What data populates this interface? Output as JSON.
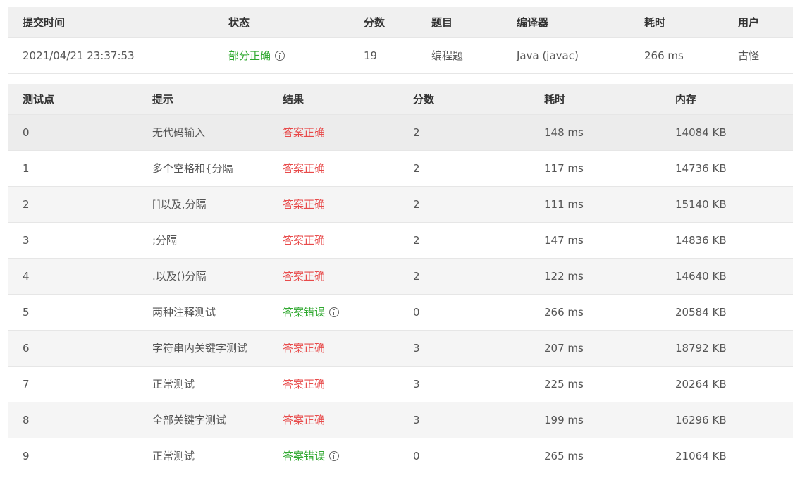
{
  "submission": {
    "headers": [
      "提交时间",
      "状态",
      "分数",
      "题目",
      "编译器",
      "耗时",
      "用户"
    ],
    "row": {
      "time": "2021/04/21 23:37:53",
      "status": "部分正确",
      "score": "19",
      "problem": "编程题",
      "compiler": "Java (javac)",
      "duration": "266 ms",
      "user": "古怪"
    }
  },
  "tests": {
    "headers": [
      "测试点",
      "提示",
      "结果",
      "分数",
      "耗时",
      "内存"
    ],
    "rows": [
      {
        "id": "0",
        "hint": "无代码输入",
        "result": "答案正确",
        "score": "2",
        "time": "148 ms",
        "memory": "14084 KB"
      },
      {
        "id": "1",
        "hint": "多个空格和{分隔",
        "result": "答案正确",
        "score": "2",
        "time": "117 ms",
        "memory": "14736 KB"
      },
      {
        "id": "2",
        "hint": "[]以及,分隔",
        "result": "答案正确",
        "score": "2",
        "time": "111 ms",
        "memory": "15140 KB"
      },
      {
        "id": "3",
        "hint": ";分隔",
        "result": "答案正确",
        "score": "2",
        "time": "147 ms",
        "memory": "14836 KB"
      },
      {
        "id": "4",
        "hint": ".以及()分隔",
        "result": "答案正确",
        "score": "2",
        "time": "122 ms",
        "memory": "14640 KB"
      },
      {
        "id": "5",
        "hint": "两种注释测试",
        "result": "答案错误",
        "score": "0",
        "time": "266 ms",
        "memory": "20584 KB"
      },
      {
        "id": "6",
        "hint": "字符串内关键字测试",
        "result": "答案正确",
        "score": "3",
        "time": "207 ms",
        "memory": "18792 KB"
      },
      {
        "id": "7",
        "hint": "正常测试",
        "result": "答案正确",
        "score": "3",
        "time": "225 ms",
        "memory": "20264 KB"
      },
      {
        "id": "8",
        "hint": "全部关键字测试",
        "result": "答案正确",
        "score": "3",
        "time": "199 ms",
        "memory": "16296 KB"
      },
      {
        "id": "9",
        "hint": "正常测试",
        "result": "答案错误",
        "score": "0",
        "time": "265 ms",
        "memory": "21064 KB"
      }
    ]
  },
  "colors": {
    "correct": "#e84a4a",
    "wrong": "#2fa82f",
    "partial": "#2fa82f",
    "header_bg": "#f0f0f0"
  },
  "icons": {
    "status_info": "info-circle-icon",
    "result_info": "info-circle-icon"
  }
}
